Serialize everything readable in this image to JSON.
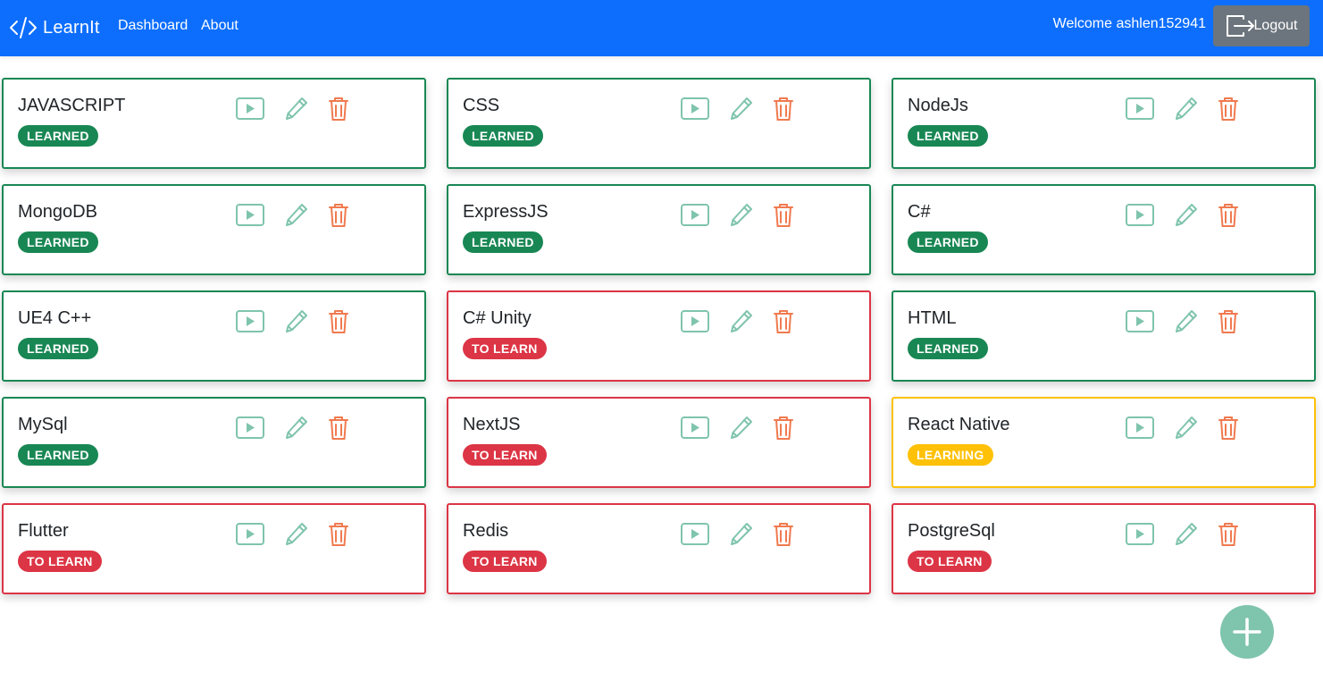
{
  "navbar": {
    "brand": "LearnIt",
    "brand_icon": "code-icon",
    "links": [
      "Dashboard",
      "About"
    ],
    "welcome": "Welcome ashlen152941",
    "logout_label": "Logout",
    "logout_icon": "logout-icon",
    "color": "#0d6efd"
  },
  "status_colors": {
    "LEARNED": "#198754",
    "TO LEARN": "#dc3545",
    "LEARNING": "#ffc107"
  },
  "actions": {
    "play_icon": "play-icon",
    "edit_icon": "pencil-icon",
    "delete_icon": "trash-icon"
  },
  "posts": [
    {
      "title": "JAVASCRIPT",
      "status": "LEARNED"
    },
    {
      "title": "CSS",
      "status": "LEARNED"
    },
    {
      "title": "NodeJs",
      "status": "LEARNED"
    },
    {
      "title": "MongoDB",
      "status": "LEARNED"
    },
    {
      "title": "ExpressJS",
      "status": "LEARNED"
    },
    {
      "title": "C#",
      "status": "LEARNED"
    },
    {
      "title": "UE4 C++",
      "status": "LEARNED"
    },
    {
      "title": "C# Unity",
      "status": "TO LEARN"
    },
    {
      "title": "HTML",
      "status": "LEARNED"
    },
    {
      "title": "MySql",
      "status": "LEARNED"
    },
    {
      "title": "NextJS",
      "status": "TO LEARN"
    },
    {
      "title": "React Native",
      "status": "LEARNING"
    },
    {
      "title": "Flutter",
      "status": "TO LEARN"
    },
    {
      "title": "Redis",
      "status": "TO LEARN"
    },
    {
      "title": "PostgreSql",
      "status": "TO LEARN"
    }
  ],
  "add_button_icon": "plus-icon"
}
